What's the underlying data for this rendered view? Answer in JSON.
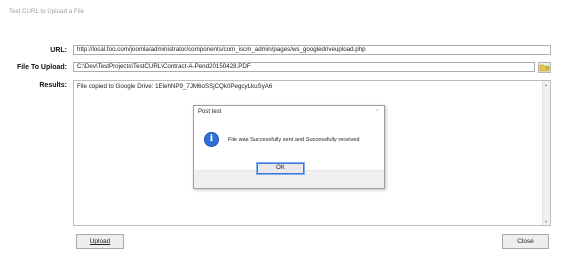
{
  "window": {
    "title": "Test CURL to Upload a File"
  },
  "form": {
    "url_label": "URL:",
    "url_value": "http://local.foo.com/joomla/administrator/components/com_iscm_admin/pages/ws_googledriveupload.php",
    "file_label": "File To Upload:",
    "file_value": "C:\\Dev\\TestProjects\\TestCURL\\Contract-A-Pend20150428.PDF",
    "browse_icon": "folder-icon",
    "results_label": "Results:",
    "results_value": "File copied to Google Drive: 1ElehNP9_7JM6oSSjCQk0PegcyLkuSyA6"
  },
  "buttons": {
    "upload": "Upload",
    "close": "Close"
  },
  "dialog": {
    "title": "Post test",
    "close_glyph": "×",
    "icon": "info-icon",
    "message": "File was Successfully sent and Successfully received",
    "ok": "OK"
  },
  "colors": {
    "accent": "#3a7bd5",
    "info_icon": "#2f6fd6",
    "folder_icon": "#8db33a"
  }
}
